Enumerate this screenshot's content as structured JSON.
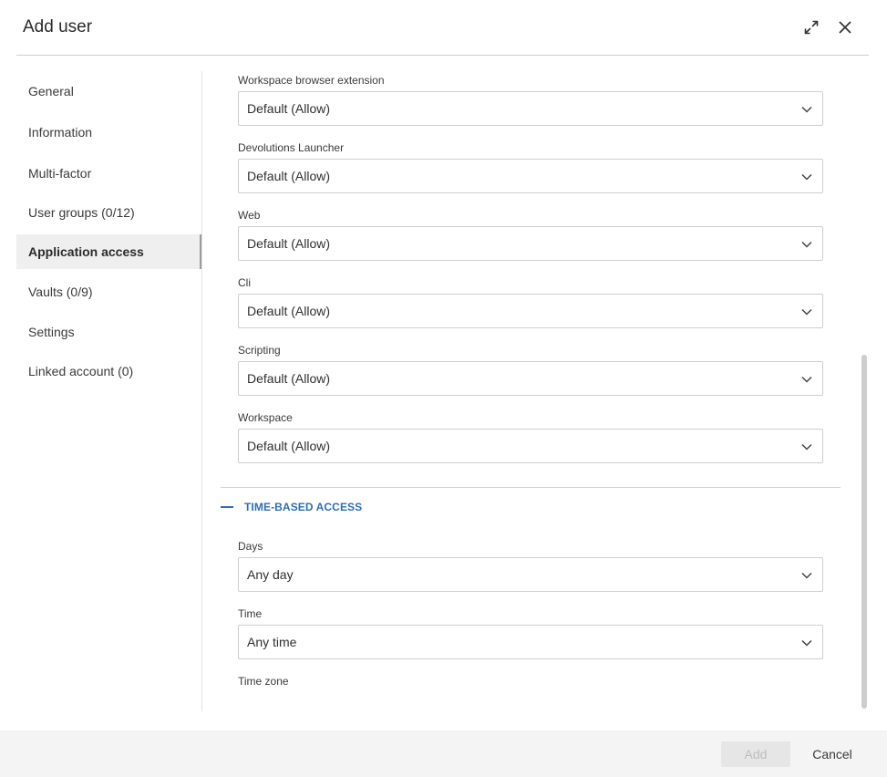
{
  "dialog": {
    "title": "Add user",
    "expand_icon": "expand-icon",
    "close_icon": "close-icon"
  },
  "sidebar": {
    "items": [
      {
        "label": "General"
      },
      {
        "label": "Information"
      },
      {
        "label": "Multi-factor"
      },
      {
        "label": "User groups (0/12)"
      },
      {
        "label": "Application access",
        "active": true
      },
      {
        "label": "Vaults (0/9)"
      },
      {
        "label": "Settings"
      },
      {
        "label": "Linked account (0)"
      }
    ]
  },
  "application_access": {
    "fields": [
      {
        "label": "Workspace browser extension",
        "value": "Default (Allow)"
      },
      {
        "label": "Devolutions Launcher",
        "value": "Default (Allow)"
      },
      {
        "label": "Web",
        "value": "Default (Allow)"
      },
      {
        "label": "Cli",
        "value": "Default (Allow)"
      },
      {
        "label": "Scripting",
        "value": "Default (Allow)"
      },
      {
        "label": "Workspace",
        "value": "Default (Allow)"
      }
    ]
  },
  "time_based_access": {
    "heading": "TIME-BASED ACCESS",
    "days": {
      "label": "Days",
      "value": "Any day"
    },
    "time": {
      "label": "Time",
      "value": "Any time"
    },
    "time_zone": {
      "label": "Time zone"
    }
  },
  "footer": {
    "add_label": "Add",
    "cancel_label": "Cancel"
  },
  "colors": {
    "accent": "#2f6db5",
    "active_nav_bg": "#efefef",
    "footer_bg": "#f4f4f4"
  }
}
